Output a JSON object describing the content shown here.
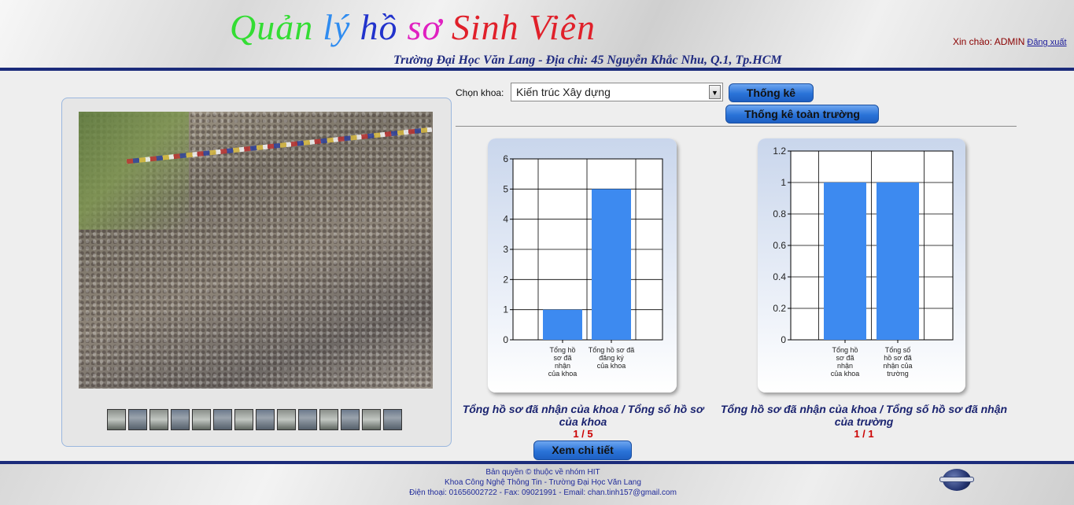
{
  "header": {
    "title_words": [
      {
        "text": "Quản",
        "color": "#33dd33"
      },
      {
        "text": "lý",
        "color": "#2f8cf0"
      },
      {
        "text": "hồ",
        "color": "#2233cc"
      },
      {
        "text": "sơ",
        "color": "#e020c0"
      },
      {
        "text": "Sinh Viên",
        "color": "#e0202a"
      }
    ],
    "subtitle": "Trường Đại Học Văn Lang - Địa chỉ: 45 Nguyễn Khắc Nhu, Q.1, Tp.HCM",
    "greeting": "Xin chào: ADMIN",
    "logout": "Đăng xuất"
  },
  "slideshow": {
    "thumbnail_count": 14
  },
  "controls": {
    "khoa_label": "Chọn khoa:",
    "khoa_selected": "Kiến trúc Xây dựng",
    "btn_thong_ke": "Thống kê",
    "btn_thong_ke_toan_truong": "Thống kê toàn trường",
    "btn_xem_chi_tiet": "Xem chi tiết"
  },
  "chart_data": [
    {
      "type": "bar",
      "categories": [
        "Tổng hồ sơ đã nhận của khoa",
        "Tổng hồ sơ đã đăng ký của khoa"
      ],
      "category_lines": [
        [
          "Tổng hồ",
          "sơ đã",
          "nhận",
          "của khoa"
        ],
        [
          "Tổng hồ sơ đã",
          "đăng ký",
          "của khoa"
        ]
      ],
      "values": [
        1,
        5
      ],
      "ylim": [
        0,
        6
      ],
      "yticks": [
        "0",
        "1",
        "2",
        "3",
        "4",
        "5",
        "6"
      ],
      "grid": true,
      "bar_color": "#3d8af0",
      "caption": "Tổng hồ sơ đã nhận của khoa / Tổng số hồ sơ của khoa",
      "ratio": "1 / 5"
    },
    {
      "type": "bar",
      "categories": [
        "Tổng hồ sơ đã nhận của khoa",
        "Tổng số hồ sơ đã nhận của trường"
      ],
      "category_lines": [
        [
          "Tổng hồ",
          "sơ đã",
          "nhận",
          "của khoa"
        ],
        [
          "Tổng số",
          "hồ sơ đã",
          "nhận của",
          "trường"
        ]
      ],
      "values": [
        1,
        1
      ],
      "ylim": [
        0,
        1.2
      ],
      "yticks": [
        "0",
        "0.2",
        "0.4",
        "0.6",
        "0.8",
        "1",
        "1.2"
      ],
      "grid": true,
      "bar_color": "#3d8af0",
      "caption": "Tổng hồ sơ đã nhận của khoa / Tổng số hồ sơ đã nhận của trường",
      "ratio": "1 / 1"
    }
  ],
  "footer": {
    "line1": "Bản quyền © thuộc về nhóm HIT",
    "line2": "Khoa Công Nghệ Thông Tin - Trường Đại Học Văn Lang",
    "line3": "Điện thoại: 01656002722 - Fax: 09021991 - Email: chan.tinh157@gmail.com"
  }
}
